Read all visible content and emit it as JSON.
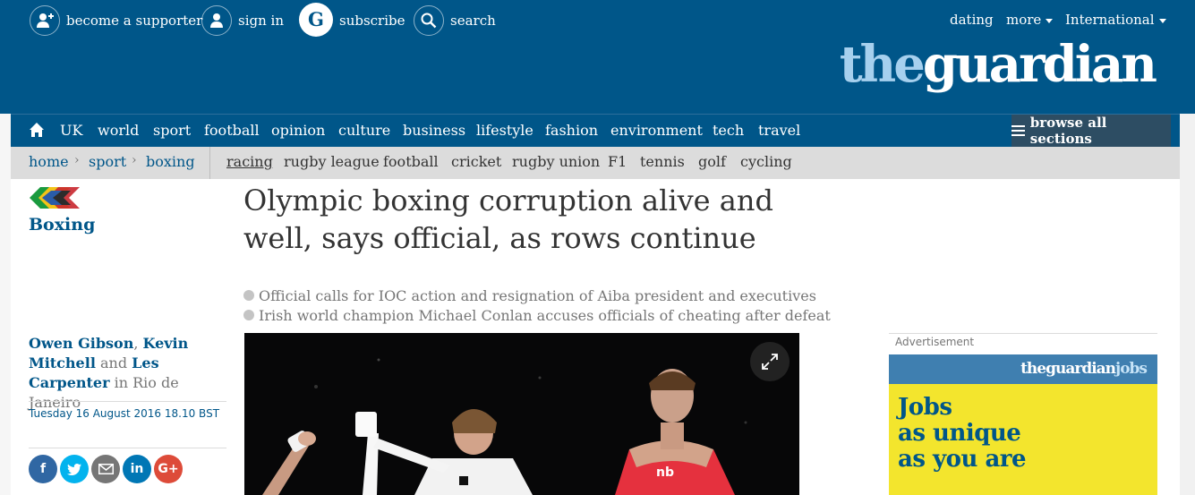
{
  "header": {
    "links": [
      {
        "label": "become a supporter",
        "icon": "add-user-icon"
      },
      {
        "label": "sign in",
        "icon": "user-icon"
      },
      {
        "label": "subscribe",
        "icon": "guardian-g-icon"
      },
      {
        "label": "search",
        "icon": "search-icon"
      }
    ],
    "right_links": [
      {
        "label": "dating"
      },
      {
        "label": "more"
      },
      {
        "label": "International"
      }
    ],
    "logo": {
      "the": "the",
      "rest": "guardian"
    }
  },
  "nav": {
    "items": [
      "UK",
      "world",
      "sport",
      "football",
      "opinion",
      "culture",
      "business",
      "lifestyle",
      "fashion",
      "environment",
      "tech",
      "travel"
    ],
    "browse_label": "browse all sections"
  },
  "subnav": {
    "breadcrumbs": [
      "home",
      "sport",
      "boxing"
    ],
    "items": [
      "racing",
      "rugby league",
      "football",
      "cricket",
      "rugby union",
      "F1",
      "tennis",
      "golf",
      "cycling"
    ],
    "current": "racing"
  },
  "article": {
    "section": "Boxing",
    "headline": "Olympic boxing corruption alive and well, says official, as rows continue",
    "standfirst": [
      "Official calls for IOC action and resignation of Aiba president and executives",
      "Irish world champion Michael Conlan accuses officials of cheating after defeat"
    ],
    "byline": {
      "authors": [
        "Owen Gibson",
        "Kevin Mitchell",
        "Les Carpenter"
      ],
      "sep1": ", ",
      "and": " and ",
      "location": " in Rio de Janeiro"
    },
    "date": "Tuesday 16 August 2016 18.10 BST",
    "share": [
      {
        "icon": "facebook-icon",
        "glyph": "f",
        "color": "#3067a3"
      },
      {
        "icon": "twitter-icon",
        "glyph": "",
        "color": "#03b3ee"
      },
      {
        "icon": "email-icon",
        "glyph": "",
        "color": "#767676"
      },
      {
        "icon": "linkedin-icon",
        "glyph": "in",
        "color": "#0077b5"
      },
      {
        "icon": "google-plus-icon",
        "glyph": "G+",
        "color": "#dd4b39"
      }
    ]
  },
  "ad": {
    "label": "Advertisement",
    "logo_main": "theguardian",
    "logo_jobs": "jobs",
    "lines": [
      "Jobs",
      "as unique",
      "as you are"
    ]
  },
  "colors": {
    "brand_blue": "#005689",
    "nav_dark": "#2d4d63",
    "ad_yellow": "#f3e52d"
  }
}
